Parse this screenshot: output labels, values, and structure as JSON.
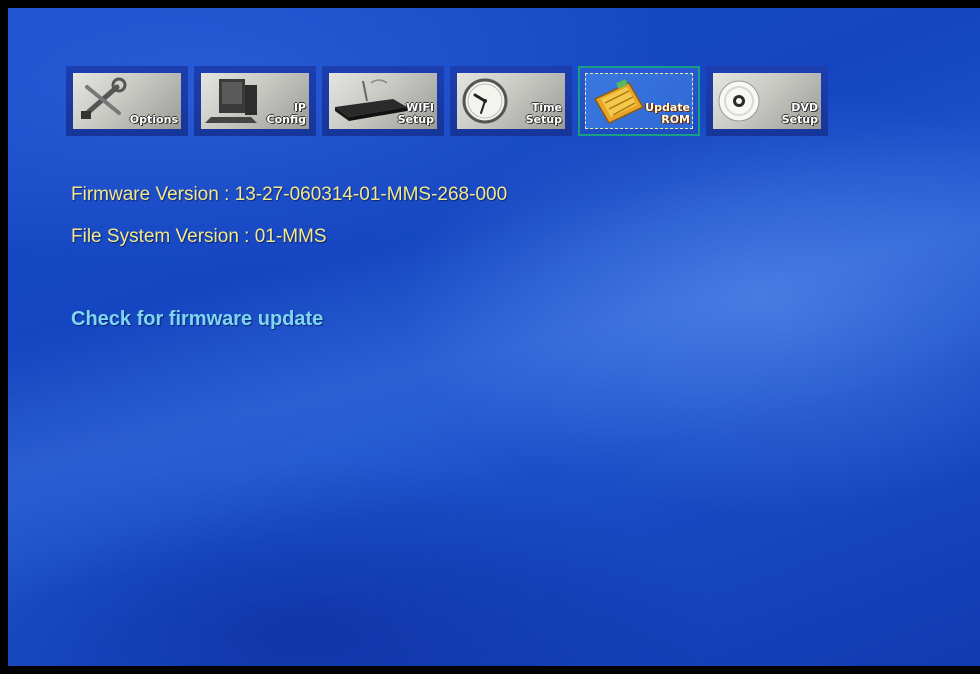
{
  "toolbar": {
    "tabs": [
      {
        "id": "options",
        "label": "Options",
        "icon": "tools-icon",
        "selected": false
      },
      {
        "id": "ip-config",
        "label": "IP\nConfig",
        "icon": "computer-icon",
        "selected": false
      },
      {
        "id": "wifi-setup",
        "label": "WIFI\nSetup",
        "icon": "router-icon",
        "selected": false
      },
      {
        "id": "time-setup",
        "label": "Time\nSetup",
        "icon": "clock-icon",
        "selected": false
      },
      {
        "id": "update-rom",
        "label": "Update\nROM",
        "icon": "chip-icon",
        "selected": true
      },
      {
        "id": "dvd-setup",
        "label": "DVD\nSetup",
        "icon": "disc-icon",
        "selected": false
      }
    ]
  },
  "info": {
    "firmware_version": "Firmware Version : 13-27-060314-01-MMS-268-000",
    "file_system_version": "File System Version : 01-MMS"
  },
  "menu": {
    "check_update": "Check for firmware update"
  },
  "colors": {
    "background": "#1a4fcc",
    "info_text": "#f3e88a",
    "menu_text": "#7fd6f2",
    "selection_outline": "#16a083"
  }
}
